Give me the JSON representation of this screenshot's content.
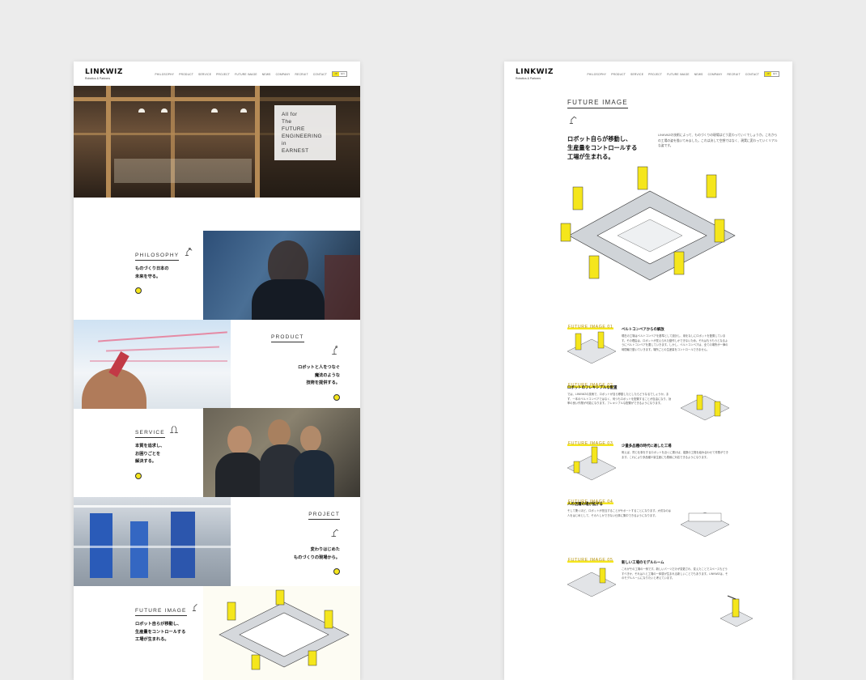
{
  "left_page": {
    "brand": {
      "logo": "LINKWIZ",
      "tagline": "Robotics & Partners"
    },
    "nav": [
      "PHILOSOPHY",
      "PRODUCT",
      "SERVICE",
      "PROJECT",
      "FUTURE IMAGE",
      "NEWS",
      "COMPANY",
      "RECRUIT",
      "CONTACT"
    ],
    "lang": [
      "JP",
      "EN"
    ],
    "hero": {
      "lines": [
        "All for",
        "The",
        "FUTURE",
        "ENGINEERING",
        "in",
        "EARNEST"
      ]
    },
    "sections": [
      {
        "title": "PHILOSOPHY",
        "body": [
          "ものづくり日本の",
          "未来を守る。"
        ]
      },
      {
        "title": "PRODUCT",
        "body": [
          "ロボットと人をつなぐ",
          "魔法のような",
          "技術を提供する。"
        ]
      },
      {
        "title": "SERVICE",
        "body": [
          "本質を追求し、",
          "お困りごとを",
          "解決する。"
        ]
      },
      {
        "title": "PROJECT",
        "body": [
          "変わりはじめた",
          "ものづくりの現場から。"
        ]
      },
      {
        "title": "FUTURE IMAGE",
        "body": [
          "ロボット自らが移動し、",
          "生産量をコントロールする",
          "工場が生まれる。"
        ]
      }
    ]
  },
  "right_page": {
    "brand": {
      "logo": "LINKWIZ",
      "tagline": "Robotics & Partners"
    },
    "nav": [
      "PHILOSOPHY",
      "PRODUCT",
      "SERVICE",
      "PROJECT",
      "FUTURE IMAGE",
      "NEWS",
      "COMPANY",
      "RECRUIT",
      "CONTACT"
    ],
    "lang": [
      "JP",
      "EN"
    ],
    "title": "FUTURE IMAGE",
    "headline": [
      "ロボット自らが移動し、",
      "生産量をコントロールする",
      "工場が生まれる。"
    ],
    "lead": "LINKWIZの技術によって、ものづくりの現場はどう変わっていくでしょうか。これからの工場の姿を描いてみました。これは決して空想ではなく、現実に変わっていくリアルな姿です。",
    "items": [
      {
        "label": "FUTURE IMAGE 01",
        "heading": "ベルトコンベアからの解放",
        "body": "現在の工場はベルトコンベアを基準として設計し、用をなしにロボットを配置しています。その理由は、ロボットが覚えられた動作しかできないため。それはもうもうとなるようにベルトコンベアを要していきます。しかし、ベルトコンベアは、全ての場所が一律の時間軸で動いていきます。場所ごとの生産量をコントロールできません。"
      },
      {
        "label": "FUTURE IMAGE 02",
        "heading": "ロボットのフレキシブルな配置",
        "body": "では、LINKWIZの技術で、ロボットが自ら移動したとしたらどうなるでしょうか。まず、一本のベルトコンベアではなく、何つもロボットを配置することが自由になり、効率の良い作業が可能になります。フレキシブルな配置ができるようになります。"
      },
      {
        "label": "FUTURE IMAGE 03",
        "heading": "少量多品種の時代に適した工場",
        "body": "例えば、同じ仕事をするロボットを近くに置けば、複数の工程を組み合わせて作業ができます。これにより多品種少量生産にも柔軟に対応できるようになります。"
      },
      {
        "label": "FUTURE IMAGE 04",
        "heading": "人の活躍の場が拡がる",
        "body": "そして驚くほど、ロボットが担当することがサポートすることになります。大切なのは人をはじめとして、その人しかできない仕事に集中できるようになります。"
      },
      {
        "label": "FUTURE IMAGE 05",
        "heading": "新しい工場のモデルルーム",
        "body": "これがその工場の一例です。新しいパーツだけが変更され、変えたことでスペースもどうすべきか、それは人と工場の一体感が生まれる新しいことでもあります。LINKWIZは、そのモデルルームになりたいと考えています。"
      }
    ]
  },
  "colors": {
    "accent": "#f5e61c",
    "background": "#ececec"
  }
}
